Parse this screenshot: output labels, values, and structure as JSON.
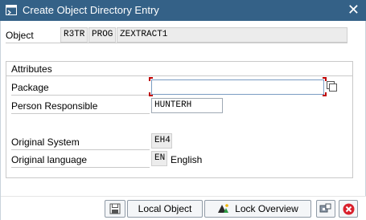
{
  "window": {
    "title": "Create Object Directory Entry",
    "close_symbol": "✕"
  },
  "object": {
    "label": "Object",
    "pgmid": "R3TR",
    "type": "PROG",
    "name": "ZEXTRACT1"
  },
  "attributes": {
    "title": "Attributes",
    "package": {
      "label": "Package",
      "value": ""
    },
    "person_responsible": {
      "label": "Person Responsible",
      "value": "HUNTERH"
    },
    "original_system": {
      "label": "Original System",
      "value": "EH4"
    },
    "original_language": {
      "label": "Original language",
      "code": "EN",
      "text": "English"
    }
  },
  "buttons": {
    "save_icon": "save-icon",
    "local_object": "Local Object",
    "lock_overview": "Lock Overview",
    "other_icon": "display-change-icon",
    "cancel_icon": "cancel-icon"
  },
  "colors": {
    "titlebar": "#346187",
    "cancel": "#d9202c",
    "focus_corner": "#c00000"
  }
}
